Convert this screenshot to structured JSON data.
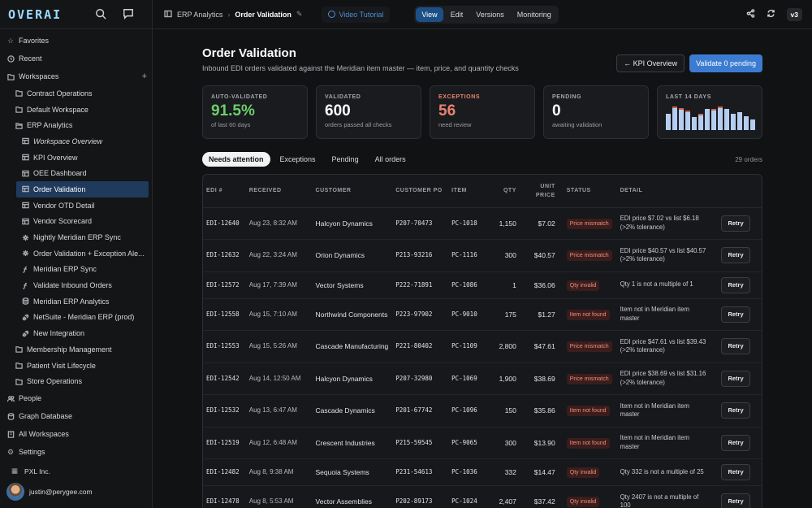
{
  "brand": {
    "logo": "OVERAI"
  },
  "sidebar": {
    "favorites": "Favorites",
    "recent": "Recent",
    "workspaces": "Workspaces",
    "items": [
      {
        "label": "Contract Operations",
        "level": 1,
        "icon": "folder"
      },
      {
        "label": "Default Workspace",
        "level": 1,
        "icon": "folder"
      },
      {
        "label": "ERP Analytics",
        "level": 1,
        "icon": "folder-open"
      },
      {
        "label": "Workspace Overview",
        "level": 2,
        "icon": "dashboard",
        "italic": true
      },
      {
        "label": "KPI Overview",
        "level": 2,
        "icon": "dashboard"
      },
      {
        "label": "OEE Dashboard",
        "level": 2,
        "icon": "dashboard"
      },
      {
        "label": "Order Validation",
        "level": 2,
        "icon": "dashboard",
        "active": true
      },
      {
        "label": "Vendor OTD Detail",
        "level": 2,
        "icon": "dashboard"
      },
      {
        "label": "Vendor Scorecard",
        "level": 2,
        "icon": "dashboard"
      },
      {
        "label": "Nightly Meridian ERP Sync",
        "level": 2,
        "icon": "workflow"
      },
      {
        "label": "Order Validation + Exception Ale...",
        "level": 2,
        "icon": "workflow"
      },
      {
        "label": "Meridian ERP Sync",
        "level": 2,
        "icon": "function"
      },
      {
        "label": "Validate Inbound Orders",
        "level": 2,
        "icon": "function"
      },
      {
        "label": "Meridian ERP Analytics",
        "level": 2,
        "icon": "database"
      },
      {
        "label": "NetSuite - Meridian ERP (prod)",
        "level": 2,
        "icon": "connector"
      },
      {
        "label": "New Integration",
        "level": 2,
        "icon": "connector"
      },
      {
        "label": "Membership Management",
        "level": 1,
        "icon": "folder"
      },
      {
        "label": "Patient Visit Lifecycle",
        "level": 1,
        "icon": "folder"
      },
      {
        "label": "Store Operations",
        "level": 1,
        "icon": "folder"
      }
    ],
    "people": "People",
    "graph_database": "Graph Database",
    "all_workspaces": "All Workspaces",
    "settings": "Settings",
    "org": "PXL Inc.",
    "user_email": "justin@perygee.com"
  },
  "topbar": {
    "breadcrumb_parent": "ERP Analytics",
    "breadcrumb_current": "Order Validation",
    "video_tutorial": "Video Tutorial",
    "modes": [
      "View",
      "Edit",
      "Versions",
      "Monitoring"
    ],
    "active_mode": "View",
    "version": "v3"
  },
  "page": {
    "title": "Order Validation",
    "subtitle": "Inbound EDI orders validated against the Meridian item master — item, price, and quantity checks",
    "kpi_button": "← KPI Overview",
    "validate_button": "Validate 0 pending"
  },
  "cards": [
    {
      "label": "AUTO-VALIDATED",
      "value": "91.5%",
      "sub": "of last 60 days",
      "color": "#6ccf6a"
    },
    {
      "label": "VALIDATED",
      "value": "600",
      "sub": "orders passed all checks",
      "color": "#ffffff"
    },
    {
      "label": "EXCEPTIONS",
      "value": "56",
      "sub": "need review",
      "color": "#e8836f",
      "label_color": "#e8836f"
    },
    {
      "label": "PENDING",
      "value": "0",
      "sub": "awaiting validation",
      "color": "#ffffff"
    }
  ],
  "trend": {
    "label": "LAST 14 DAYS",
    "fill_fraction": [
      0.72,
      0.95,
      0.9,
      0.78,
      0.58,
      0.66,
      0.93,
      0.85,
      0.97,
      0.92,
      0.72,
      0.78,
      0.62,
      0.48
    ],
    "has_exceptions": [
      false,
      true,
      true,
      true,
      false,
      true,
      false,
      true,
      true,
      false,
      false,
      false,
      false,
      false
    ]
  },
  "filters": {
    "tabs": [
      "Needs attention",
      "Exceptions",
      "Pending",
      "All orders"
    ],
    "active": "Needs attention",
    "count": "29 orders"
  },
  "table": {
    "headers": [
      "EDI #",
      "RECEIVED",
      "CUSTOMER",
      "CUSTOMER PO",
      "ITEM",
      "QTY",
      "UNIT PRICE",
      "STATUS",
      "DETAIL"
    ],
    "retry_label": "Retry",
    "rows": [
      {
        "edi": "EDI-12640",
        "received": "Aug 23, 8:32 AM",
        "customer": "Halcyon Dynamics",
        "po": "P207-70473",
        "item": "PC-1018",
        "qty": "1,150",
        "price": "$7.02",
        "status": "Price mismatch",
        "detail": "EDI price $7.02 vs list $6.18 (>2% tolerance)"
      },
      {
        "edi": "EDI-12632",
        "received": "Aug 22, 3:24 AM",
        "customer": "Orion Dynamics",
        "po": "P213-93216",
        "item": "PC-1116",
        "qty": "300",
        "price": "$40.57",
        "status": "Price mismatch",
        "detail": "EDI price $40.57 vs list $40.57 (>2% tolerance)"
      },
      {
        "edi": "EDI-12572",
        "received": "Aug 17, 7:39 AM",
        "customer": "Vector Systems",
        "po": "P222-71891",
        "item": "PC-1086",
        "qty": "1",
        "price": "$36.06",
        "status": "Qty invalid",
        "detail": "Qty 1 is not a multiple of 1"
      },
      {
        "edi": "EDI-12558",
        "received": "Aug 15, 7:10 AM",
        "customer": "Northwind Components",
        "po": "P223-97902",
        "item": "PC-9010",
        "qty": "175",
        "price": "$1.27",
        "status": "Item not found",
        "detail": "Item not in Meridian item master"
      },
      {
        "edi": "EDI-12553",
        "received": "Aug 15, 5:26 AM",
        "customer": "Cascade Manufacturing",
        "po": "P221-80402",
        "item": "PC-1109",
        "qty": "2,800",
        "price": "$47.61",
        "status": "Price mismatch",
        "detail": "EDI price $47.61 vs list $39.43 (>2% tolerance)"
      },
      {
        "edi": "EDI-12542",
        "received": "Aug 14, 12:50 AM",
        "customer": "Halcyon Dynamics",
        "po": "P207-32980",
        "item": "PC-1069",
        "qty": "1,900",
        "price": "$38.69",
        "status": "Price mismatch",
        "detail": "EDI price $38.69 vs list $31.16 (>2% tolerance)"
      },
      {
        "edi": "EDI-12532",
        "received": "Aug 13, 6:47 AM",
        "customer": "Cascade Dynamics",
        "po": "P201-67742",
        "item": "PC-1096",
        "qty": "150",
        "price": "$35.86",
        "status": "Item not found",
        "detail": "Item not in Meridian item master"
      },
      {
        "edi": "EDI-12519",
        "received": "Aug 12, 6:48 AM",
        "customer": "Crescent Industries",
        "po": "P215-59545",
        "item": "PC-9065",
        "qty": "300",
        "price": "$13.90",
        "status": "Item not found",
        "detail": "Item not in Meridian item master"
      },
      {
        "edi": "EDI-12482",
        "received": "Aug 8, 9:38 AM",
        "customer": "Sequoia Systems",
        "po": "P231-54613",
        "item": "PC-1036",
        "qty": "332",
        "price": "$14.47",
        "status": "Qty invalid",
        "detail": "Qty 332 is not a multiple of 25"
      },
      {
        "edi": "EDI-12478",
        "received": "Aug 8, 5:53 AM",
        "customer": "Vector Assemblies",
        "po": "P202-89173",
        "item": "PC-1024",
        "qty": "2,407",
        "price": "$37.42",
        "status": "Qty invalid",
        "detail": "Qty 2407 is not a multiple of 100"
      }
    ]
  }
}
